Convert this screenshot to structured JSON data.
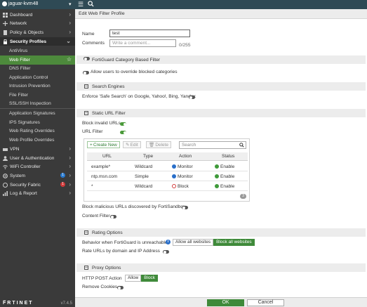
{
  "topbar": {
    "device_name": "jaguar-kvm48"
  },
  "sidebar": {
    "items": [
      {
        "label": "Dashboard",
        "icon": "dashboard-icon"
      },
      {
        "label": "Network",
        "icon": "network-icon"
      },
      {
        "label": "Policy & Objects",
        "icon": "policy-icon"
      },
      {
        "label": "Security Profiles",
        "icon": "lock-icon"
      }
    ],
    "sub_items": [
      "AntiVirus",
      "Web Filter",
      "DNS Filter",
      "Application Control",
      "Intrusion Prevention",
      "File Filter",
      "SSL/SSH Inspection",
      "Application Signatures",
      "IPS Signatures",
      "Web Rating Overrides",
      "Web Profile Overrides"
    ],
    "lower_items": [
      {
        "label": "VPN",
        "icon": "vpn-icon"
      },
      {
        "label": "User & Authentication",
        "icon": "user-icon"
      },
      {
        "label": "WiFi Controller",
        "icon": "wifi-icon"
      },
      {
        "label": "System",
        "icon": "gear-icon",
        "badge": "1"
      },
      {
        "label": "Security Fabric",
        "icon": "fabric-icon",
        "badge": "1"
      },
      {
        "label": "Log & Report",
        "icon": "log-icon"
      }
    ],
    "brand": "F̅RTINET",
    "version": "v7.4.5"
  },
  "page": {
    "title": "Edit Web Filter Profile",
    "name_label": "Name",
    "name_value": "test",
    "comments_label": "Comments",
    "comments_placeholder": "Write a comment...",
    "comments_counter": "0/255",
    "fortiguard_category": "FortiGuard Category Based Filter",
    "allow_override": "Allow users to override blocked categories",
    "search_engines": "Search Engines",
    "safe_search": "Enforce 'Safe Search' on Google, Yahoo!, Bing, Yandex",
    "static_url": "Static URL Filter",
    "block_invalid": "Block invalid URLs",
    "url_filter": "URL Filter",
    "create_new": "Create New",
    "edit": "Edit",
    "delete": "Delete",
    "search_placeholder": "Search",
    "columns": [
      "URL",
      "Type",
      "Action",
      "Status"
    ],
    "rows": [
      {
        "url": "example*",
        "type": "Wildcard",
        "action": "Monitor",
        "status": "Enable"
      },
      {
        "url": "ntp.msn.com",
        "type": "Simple",
        "action": "Monitor",
        "status": "Enable"
      },
      {
        "url": "*",
        "type": "Wildcard",
        "action": "Block",
        "status": "Enable"
      }
    ],
    "row_count": "3",
    "block_malicious": "Block malicious URLs discovered by FortiSandbox",
    "content_filter": "Content Filter",
    "rating_options": "Rating Options",
    "behavior_unreachable": "Behavior when FortiGuard is unreachable",
    "allow_all": "Allow all websites",
    "block_all": "Block all websites",
    "rate_urls": "Rate URLs by domain and IP Address",
    "proxy_options": "Proxy Options",
    "http_post": "HTTP POST Action",
    "allow": "Allow",
    "block": "Block",
    "remove_cookies": "Remove Cookies"
  },
  "footer": {
    "ok": "OK",
    "cancel": "Cancel"
  },
  "colors": {
    "accent": "#3f8a3a",
    "sidebar": "#3a3a3a",
    "topbar": "#2f4a55"
  }
}
